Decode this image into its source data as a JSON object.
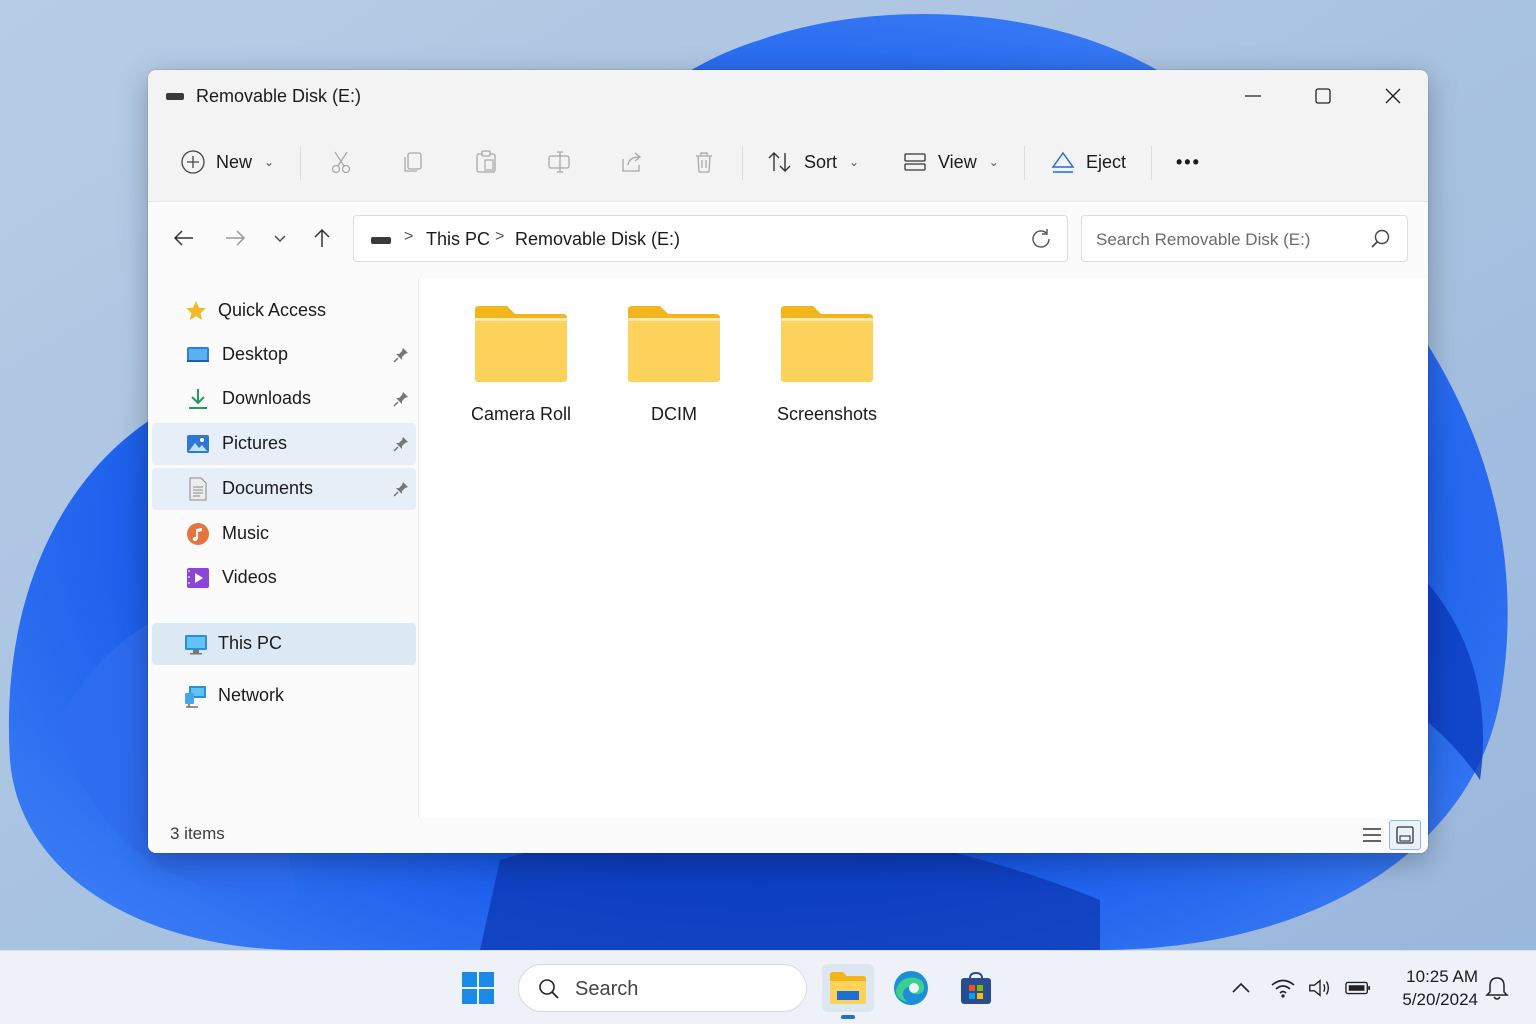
{
  "window": {
    "title": "Removable Disk (E:)"
  },
  "toolbar": {
    "new_label": "New",
    "sort_label": "Sort",
    "view_label": "View",
    "eject_label": "Eject",
    "more_label": "•••"
  },
  "address": {
    "crumbs": [
      "This PC",
      "Removable Disk (E:)"
    ],
    "separator": ">"
  },
  "search": {
    "placeholder": "Search Removable Disk (E:)"
  },
  "sidebar": {
    "items": [
      {
        "label": "Quick Access",
        "icon": "star-icon",
        "pinned": false
      },
      {
        "label": "Desktop",
        "icon": "desktop-icon",
        "pinned": true
      },
      {
        "label": "Downloads",
        "icon": "download-icon",
        "pinned": true
      },
      {
        "label": "Pictures",
        "icon": "pictures-icon",
        "pinned": true
      },
      {
        "label": "Documents",
        "icon": "documents-icon",
        "pinned": true
      },
      {
        "label": "Music",
        "icon": "music-icon",
        "pinned": false
      },
      {
        "label": "Videos",
        "icon": "videos-icon",
        "pinned": false
      },
      {
        "label": "This PC",
        "icon": "monitor-icon",
        "pinned": false
      },
      {
        "label": "Network",
        "icon": "network-icon",
        "pinned": false
      }
    ]
  },
  "content": {
    "folders": [
      "Camera Roll",
      "DCIM",
      "Screenshots"
    ]
  },
  "status": {
    "item_count": "3 items"
  },
  "taskbar": {
    "search_label": "Search",
    "time": "10:25 AM",
    "date": "5/20/2024"
  },
  "colors": {
    "accent": "#1f6fd0",
    "folder": "#f9c949",
    "selection": "#e6eef8"
  }
}
